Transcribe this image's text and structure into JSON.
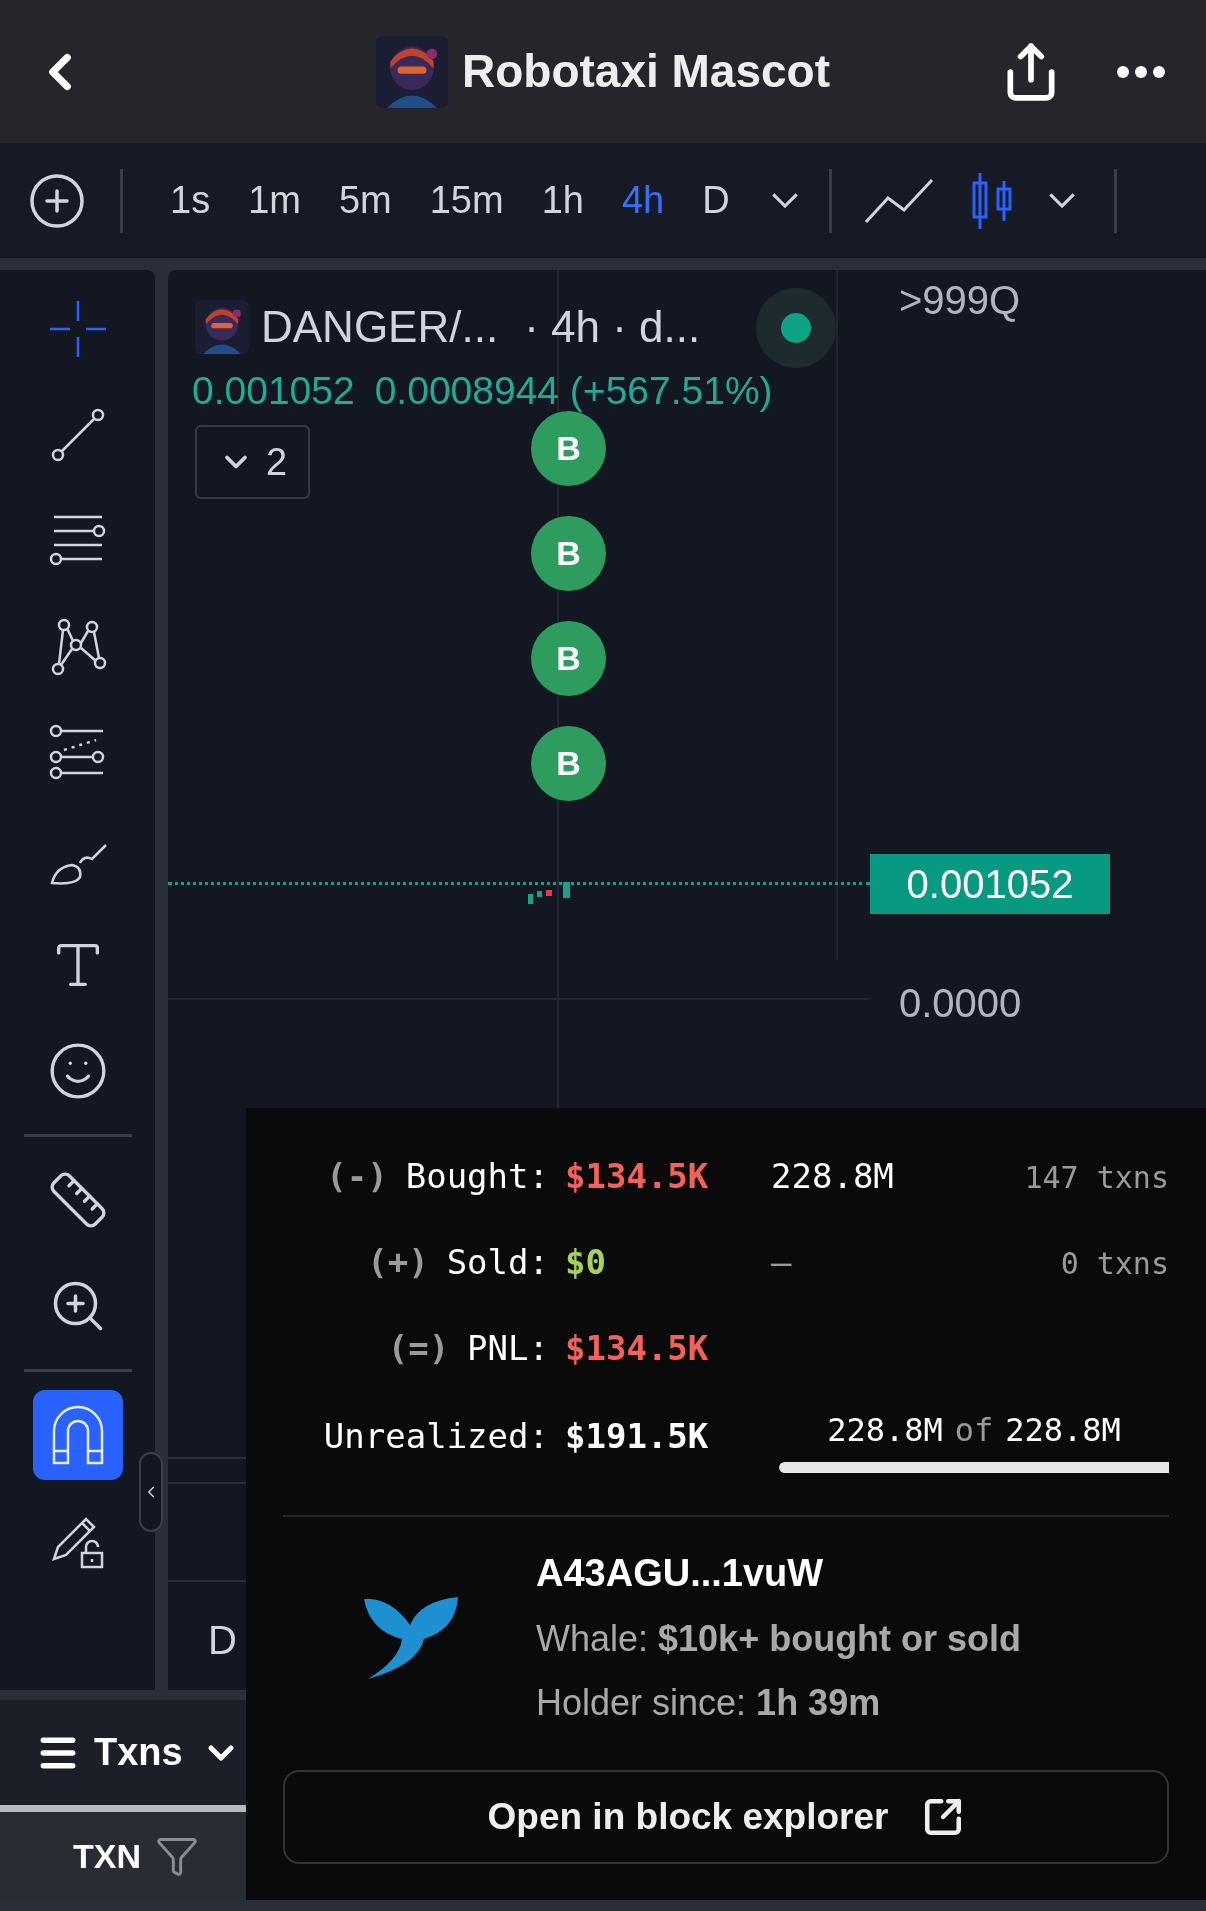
{
  "header": {
    "title": "Robotaxi Mascot"
  },
  "toolbar": {
    "timeframes": [
      {
        "label": "1s",
        "selected": false
      },
      {
        "label": "1m",
        "selected": false
      },
      {
        "label": "5m",
        "selected": false
      },
      {
        "label": "15m",
        "selected": false
      },
      {
        "label": "1h",
        "selected": false
      },
      {
        "label": "4h",
        "selected": true
      },
      {
        "label": "D",
        "selected": false
      }
    ],
    "chart_types": [
      {
        "kind": "line",
        "selected": false
      },
      {
        "kind": "candles",
        "selected": true
      }
    ]
  },
  "tool_groups": [
    [
      {
        "kind": "crosshair",
        "selected": true
      },
      {
        "kind": "trend-line",
        "selected": false
      },
      {
        "kind": "parallel-lines",
        "selected": false
      },
      {
        "kind": "pattern",
        "selected": false
      },
      {
        "kind": "fib",
        "selected": false
      },
      {
        "kind": "brush",
        "selected": false
      },
      {
        "kind": "text",
        "selected": false
      },
      {
        "kind": "emoji",
        "selected": false
      }
    ],
    [
      {
        "kind": "ruler",
        "selected": false
      },
      {
        "kind": "zoom",
        "selected": false
      }
    ],
    [
      {
        "kind": "magnet",
        "selected": true
      },
      {
        "kind": "lock-drawings",
        "selected": false
      }
    ]
  ],
  "chart": {
    "legend": {
      "symbol": "DANGER/...",
      "meta": "· 4h · d...",
      "live": true,
      "last": "0.001052",
      "change": "0.0008944 (+567.51%)",
      "indicators_count": "2"
    },
    "markers": [
      {
        "label": "B"
      },
      {
        "label": "B"
      },
      {
        "label": "B"
      },
      {
        "label": "B"
      }
    ],
    "price_axis": {
      "top_label": ">999Q",
      "current_price": "0.001052",
      "zero_label": "0.0000"
    },
    "cut_label": "D"
  },
  "popup": {
    "rows": [
      {
        "sign": "(-)",
        "label": "Bought:",
        "value": "$134.5K",
        "kind": "loss",
        "amount": "228.8M",
        "txns": "147 txns"
      },
      {
        "sign": "(+)",
        "label": "Sold:",
        "value": "$0",
        "kind": "gain",
        "amount": "–",
        "txns": "0 txns"
      },
      {
        "sign": "(=)",
        "label": "PNL:",
        "value": "$134.5K",
        "kind": "loss"
      }
    ],
    "unrealized": {
      "label": "Unrealized:",
      "value": "$191.5K",
      "held": "228.8M",
      "of": "of",
      "total": "228.8M",
      "level": 1
    },
    "wallet": {
      "address": "A43AGU...1vuW",
      "whale_line": "Whale: **$10k+ bought or sold**",
      "holder_line": "Holder since: **1h 39m**"
    },
    "button": "Open in block explorer"
  },
  "bottom": {
    "tab": "Txns",
    "column": "TXN"
  }
}
